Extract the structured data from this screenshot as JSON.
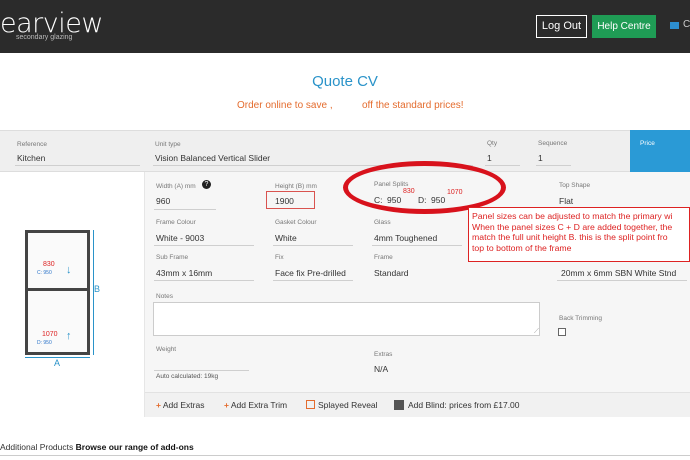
{
  "header": {
    "logo_text": "earview",
    "logo_tag": "secondary glazing",
    "logout_label": "Log Out",
    "help_label": "Help Centre",
    "mail_label": "C"
  },
  "quote": {
    "title": "Quote CV",
    "promo_part1": "Order online to save ,",
    "promo_part2": "off the standard prices!"
  },
  "reference_bar": {
    "reference_label": "Reference",
    "reference_value": "Kitchen",
    "unit_type_label": "Unit type",
    "unit_type_value": "Vision Balanced Vertical Slider",
    "qty_label": "Qty",
    "qty_value": "1",
    "sequence_label": "Sequence",
    "sequence_value": "1",
    "price_label": "Price"
  },
  "diagram": {
    "dim_b": "B",
    "dim_a": "A",
    "top_value": "830",
    "top_sub": "C: 950",
    "bottom_value": "1070",
    "bottom_sub": "D: 950"
  },
  "form": {
    "width_label": "Width (A) mm",
    "width_value": "960",
    "height_label": "Height (B) mm",
    "height_value": "1900",
    "panel_splits_label": "Panel Splits",
    "c_label": "C:",
    "c_value": "950",
    "c_extra": "830",
    "d_label": "D:",
    "d_value": "950",
    "d_extra": "1070",
    "top_shape_label": "Top Shape",
    "top_shape_value": "Flat",
    "frame_colour_label": "Frame Colour",
    "frame_colour_value": "White - 9003",
    "gasket_colour_label": "Gasket Colour",
    "gasket_colour_value": "White",
    "glass_label": "Glass",
    "glass_value": "4mm Toughened",
    "sub_frame_label": "Sub Frame",
    "sub_frame_value": "43mm x 16mm",
    "fix_label": "Fix",
    "fix_value": "Face fix Pre-drilled",
    "frame_label": "Frame",
    "frame_value": "Standard",
    "trim_value": "20mm x 6mm SBN White Stnd",
    "notes_label": "Notes",
    "back_trimming_label": "Back Trimming",
    "weight_label": "Weight",
    "weight_auto": "Auto calculated: 19kg",
    "extras_label": "Extras",
    "extras_value": "N/A"
  },
  "callout": {
    "line1": "Panel sizes can be adjusted  to match the primary wi",
    "line2": "When the panel sizes C + D are added together, the",
    "line3": "match the full unit height B. this is the split point fro",
    "line4": "top to bottom of the frame"
  },
  "actions": {
    "add_extras": "Add Extras",
    "add_extra_trim": "Add Extra Trim",
    "splayed_reveal": "Splayed Reveal",
    "add_blind": "Add Blind: prices from £17.00"
  },
  "additional": {
    "label": "Additional Products",
    "link": "Browse our range of add-ons"
  },
  "colors": {
    "header_bg": "#2b2b2b",
    "help_green": "#1f9c55",
    "accent_blue": "#2a93c9",
    "promo_orange": "#e46c2e",
    "annotation_red": "#d8121c"
  }
}
